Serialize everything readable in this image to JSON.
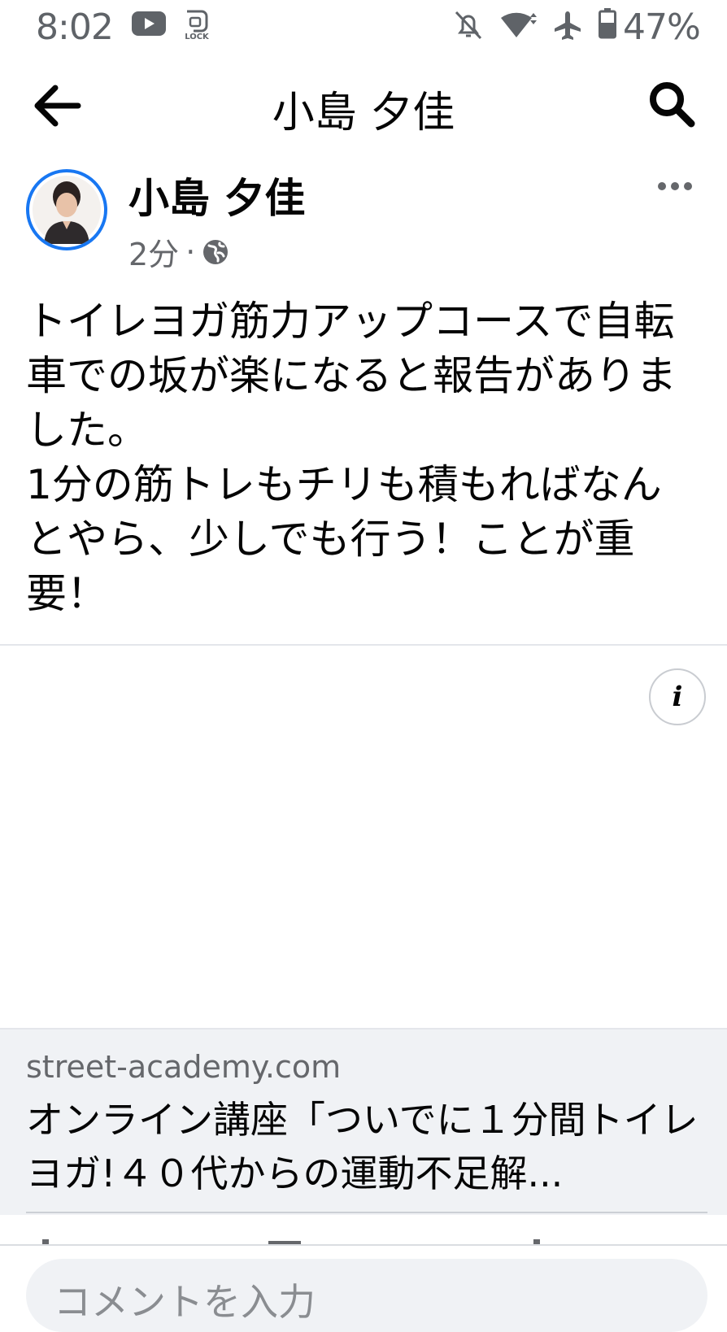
{
  "status_bar": {
    "time": "8:02",
    "battery": "47%",
    "icons": [
      "youtube-icon",
      "lock-icon",
      "notifications-off-icon",
      "wifi-icon",
      "airplane-icon",
      "battery-icon"
    ]
  },
  "header": {
    "title": "小島 夕佳",
    "back_icon": "arrow-left-icon",
    "search_icon": "search-icon"
  },
  "post": {
    "author": "小島 夕佳",
    "time_ago": "2分",
    "separator": "·",
    "audience_icon": "globe-icon",
    "more_icon": "more-horizontal-icon",
    "text_lines": [
      "トイレヨガ筋力アップコースで自転車での坂が楽になると報告がありました。",
      "1分の筋トレもチリも積もればなんとやら、少しでも行う！ことが重要！"
    ],
    "info_label": "i"
  },
  "link_preview": {
    "domain": "street-academy.com",
    "title": "オンライン講座「ついでに１分間トイレヨガ!４０代からの運動不足解..."
  },
  "comment": {
    "placeholder": "コメントを入力"
  },
  "colors": {
    "accent": "#1877f2",
    "secondary_text": "#65676b",
    "card_bg": "#f0f2f5"
  }
}
